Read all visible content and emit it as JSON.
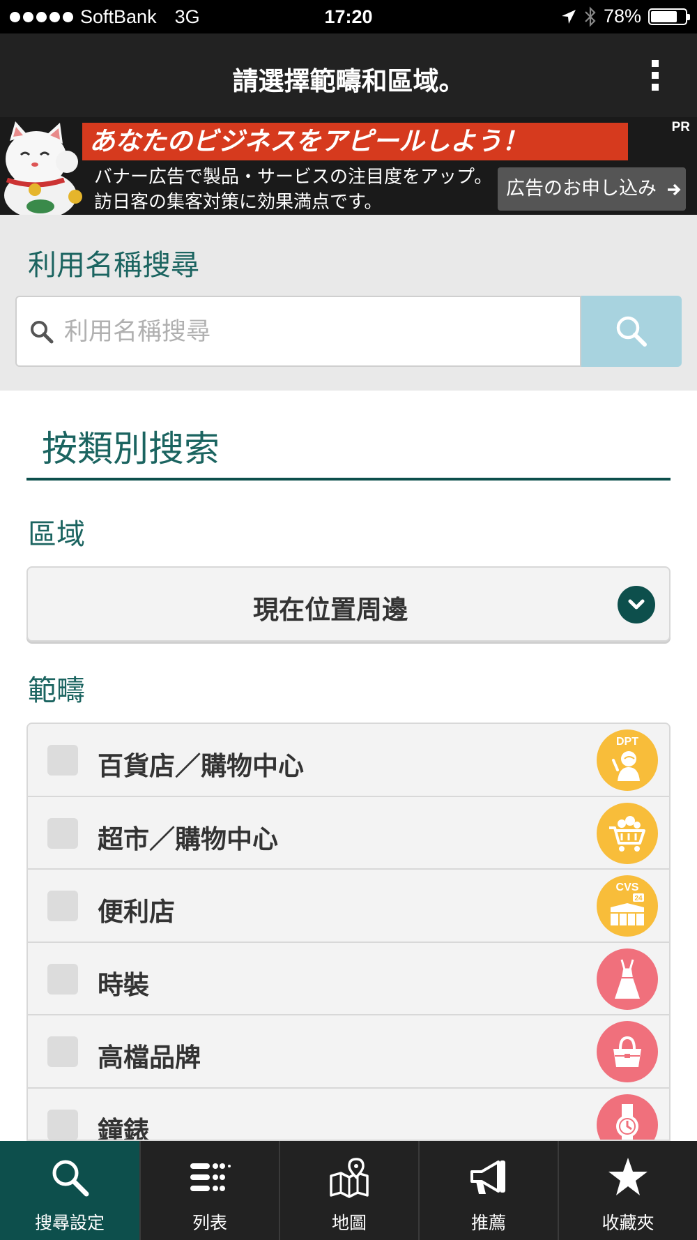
{
  "status_bar": {
    "carrier": "SoftBank",
    "network": "3G",
    "time": "17:20",
    "battery": "78%",
    "battery_level": 0.78,
    "icons": [
      "location-arrow-icon",
      "bluetooth-icon",
      "battery-icon"
    ]
  },
  "header": {
    "title": "請選擇範疇和區域。",
    "menu_icon": "kebab-menu-icon"
  },
  "ad_banner": {
    "label": "PR",
    "headline": "あなたのビジネスをアピールしよう！",
    "body_line1": "バナー広告で製品・サービスの注目度をアップ。",
    "body_line2": "訪日客の集客対策に効果満点です。",
    "cta": "広告のお申し込み",
    "accent": "#d63a1e"
  },
  "search": {
    "title": "利用名稱搜尋",
    "placeholder": "利用名稱搜尋",
    "value": ""
  },
  "category_search": {
    "heading": "按類別搜索",
    "area_label": "區域",
    "area_selected": "現在位置周邊",
    "category_label": "範疇",
    "categories": [
      {
        "label": "百貨店／購物中心",
        "icon": "department-store-icon",
        "badge": "DPT",
        "color": "#f8bd3a",
        "checked": false
      },
      {
        "label": "超市／購物中心",
        "icon": "shopping-cart-icon",
        "color": "#f8bd3a",
        "checked": false
      },
      {
        "label": "便利店",
        "icon": "convenience-store-icon",
        "badge": "CVS",
        "badge2": "24",
        "color": "#f8bd3a",
        "checked": false
      },
      {
        "label": "時裝",
        "icon": "dress-icon",
        "color": "#f0707c",
        "checked": false
      },
      {
        "label": "高檔品牌",
        "icon": "handbag-icon",
        "color": "#f0707c",
        "checked": false
      },
      {
        "label": "鐘錶",
        "icon": "watch-icon",
        "color": "#f0707c",
        "checked": false
      }
    ]
  },
  "tab_bar": {
    "tabs": [
      {
        "label": "搜尋設定",
        "icon": "search-icon",
        "active": true
      },
      {
        "label": "列表",
        "icon": "list-icon",
        "active": false
      },
      {
        "label": "地圖",
        "icon": "map-icon",
        "active": false
      },
      {
        "label": "推薦",
        "icon": "megaphone-icon",
        "active": false
      },
      {
        "label": "收藏夾",
        "icon": "star-icon",
        "active": false
      }
    ]
  },
  "colors": {
    "primary": "#0d4f4c",
    "heading": "#1b6460",
    "search_button": "#a8d3df"
  }
}
